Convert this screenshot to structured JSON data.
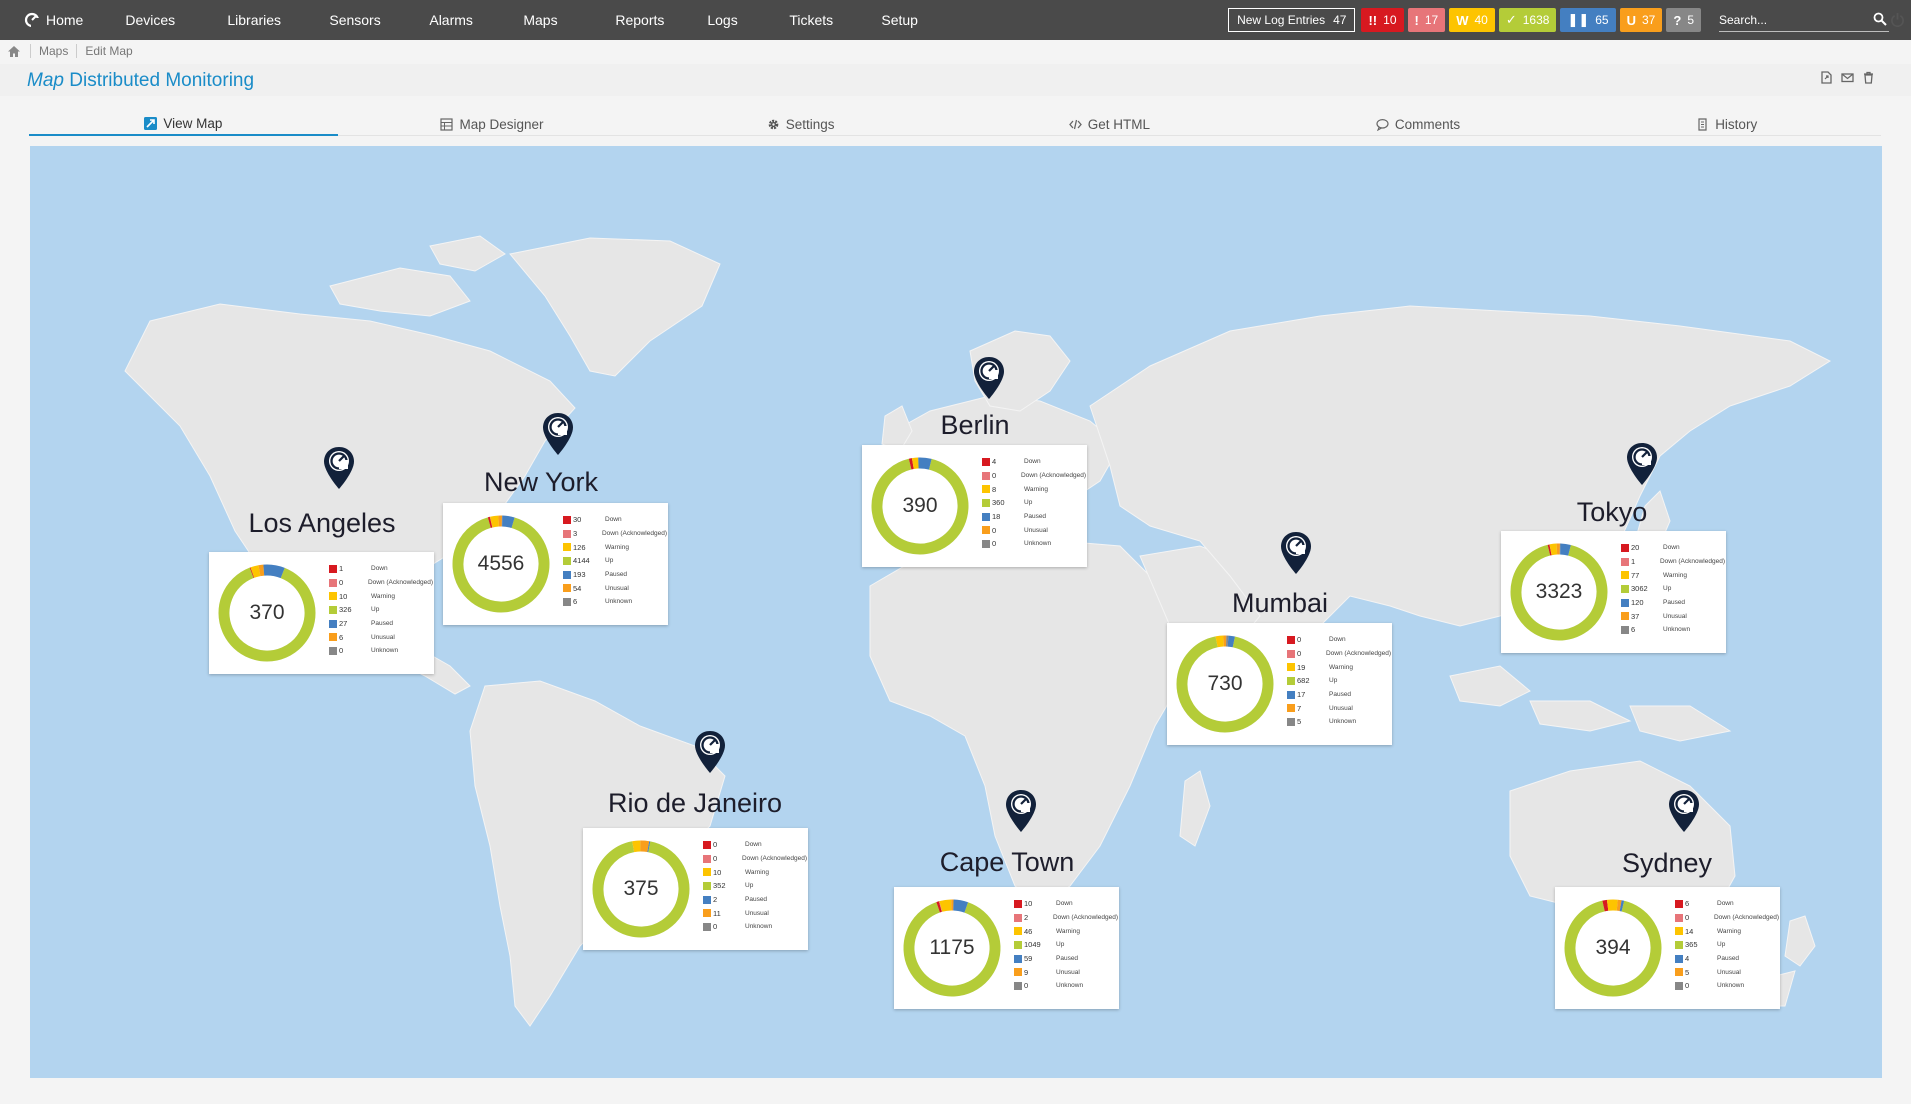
{
  "colors": {
    "topbar": "#4a4a4a",
    "accent": "#1a8cc8",
    "down": "#d71920",
    "down_ack": "#e77579",
    "warning": "#fdc400",
    "up": "#b4cc38",
    "paused": "#447fc1",
    "unusual": "#f99e1c",
    "unknown": "#878787",
    "ocean": "#b3d4ef",
    "land": "#e6e6e6"
  },
  "nav": {
    "home": "Home",
    "items": [
      "Devices",
      "Libraries",
      "Sensors",
      "Alarms",
      "Maps",
      "Reports",
      "Logs",
      "Tickets",
      "Setup"
    ]
  },
  "log_entries": {
    "label": "New Log Entries",
    "count": "47"
  },
  "status_badges": [
    {
      "glyph": "!!",
      "count": "10",
      "color": "#d71920",
      "name": "down"
    },
    {
      "glyph": "!",
      "count": "17",
      "color": "#e77579",
      "name": "down-acknowledged"
    },
    {
      "glyph": "W",
      "count": "40",
      "color": "#fdc400",
      "name": "warning"
    },
    {
      "glyph": "✓",
      "count": "1638",
      "color": "#b4cc38",
      "name": "up"
    },
    {
      "glyph": "❚❚",
      "count": "65",
      "color": "#447fc1",
      "name": "paused"
    },
    {
      "glyph": "U",
      "count": "37",
      "color": "#f99e1c",
      "name": "unusual"
    },
    {
      "glyph": "?",
      "count": "5",
      "color": "#878787",
      "name": "unknown"
    }
  ],
  "search": {
    "placeholder": "Search..."
  },
  "breadcrumb": [
    "Maps",
    "Edit Map"
  ],
  "title": {
    "prefix": "Map",
    "name": "Distributed Monitoring"
  },
  "tabs": [
    "View Map",
    "Map Designer",
    "Settings",
    "Get HTML",
    "Comments",
    "History"
  ],
  "legend_labels": [
    "Down",
    "Down (Acknowledged)",
    "Warning",
    "Up",
    "Paused",
    "Unusual",
    "Unknown"
  ],
  "cities": [
    {
      "name": "Los Angeles",
      "total": "370",
      "values": [
        1,
        0,
        10,
        326,
        27,
        6,
        0
      ]
    },
    {
      "name": "New York",
      "total": "4556",
      "values": [
        30,
        3,
        126,
        4144,
        193,
        54,
        6
      ]
    },
    {
      "name": "Berlin",
      "total": "390",
      "values": [
        4,
        0,
        8,
        360,
        18,
        0,
        0
      ]
    },
    {
      "name": "Mumbai",
      "total": "730",
      "values": [
        0,
        0,
        19,
        682,
        17,
        7,
        5
      ]
    },
    {
      "name": "Tokyo",
      "total": "3323",
      "values": [
        20,
        1,
        77,
        3062,
        120,
        37,
        6
      ]
    },
    {
      "name": "Rio de Janeiro",
      "total": "375",
      "values": [
        0,
        0,
        10,
        352,
        2,
        11,
        0
      ]
    },
    {
      "name": "Cape Town",
      "total": "1175",
      "values": [
        10,
        2,
        46,
        1049,
        59,
        9,
        0
      ]
    },
    {
      "name": "Sydney",
      "total": "394",
      "values": [
        6,
        0,
        14,
        365,
        4,
        5,
        0
      ]
    }
  ]
}
